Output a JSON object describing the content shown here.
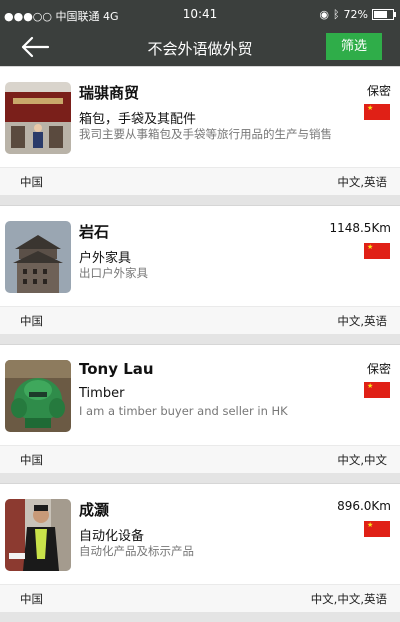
{
  "status": {
    "carrier": "●●●○○ 中国联通  4G",
    "time": "10:41",
    "battery": "72%",
    "battery_level": 0.72
  },
  "nav": {
    "title": "不会外语做外贸",
    "filter_label": "筛选"
  },
  "items": [
    {
      "name": "瑞骐商贸",
      "category": "箱包，手袋及其配件",
      "desc": "我司主要从事箱包及手袋等旅行用品的生产与销售",
      "distance": "保密",
      "country": "中国",
      "languages": "中文,英语",
      "avatar": "storefront-photo"
    },
    {
      "name": "岩石",
      "category": "户外家具",
      "desc": "出口户外家具",
      "distance": "1148.5Km",
      "country": "中国",
      "languages": "中文,英语",
      "avatar": "tower-photo"
    },
    {
      "name": "Tony Lau",
      "category": "Timber",
      "desc": "I am a timber buyer and seller in HK",
      "distance": "保密",
      "country": "中国",
      "languages": "中文,中文",
      "avatar": "robot-toy-photo"
    },
    {
      "name": "成灏",
      "category": "自动化设备",
      "desc": "自动化产品及标示产品",
      "distance": "896.0Km",
      "country": "中国",
      "languages": "中文,中文,英语",
      "avatar": "person-photo"
    }
  ]
}
